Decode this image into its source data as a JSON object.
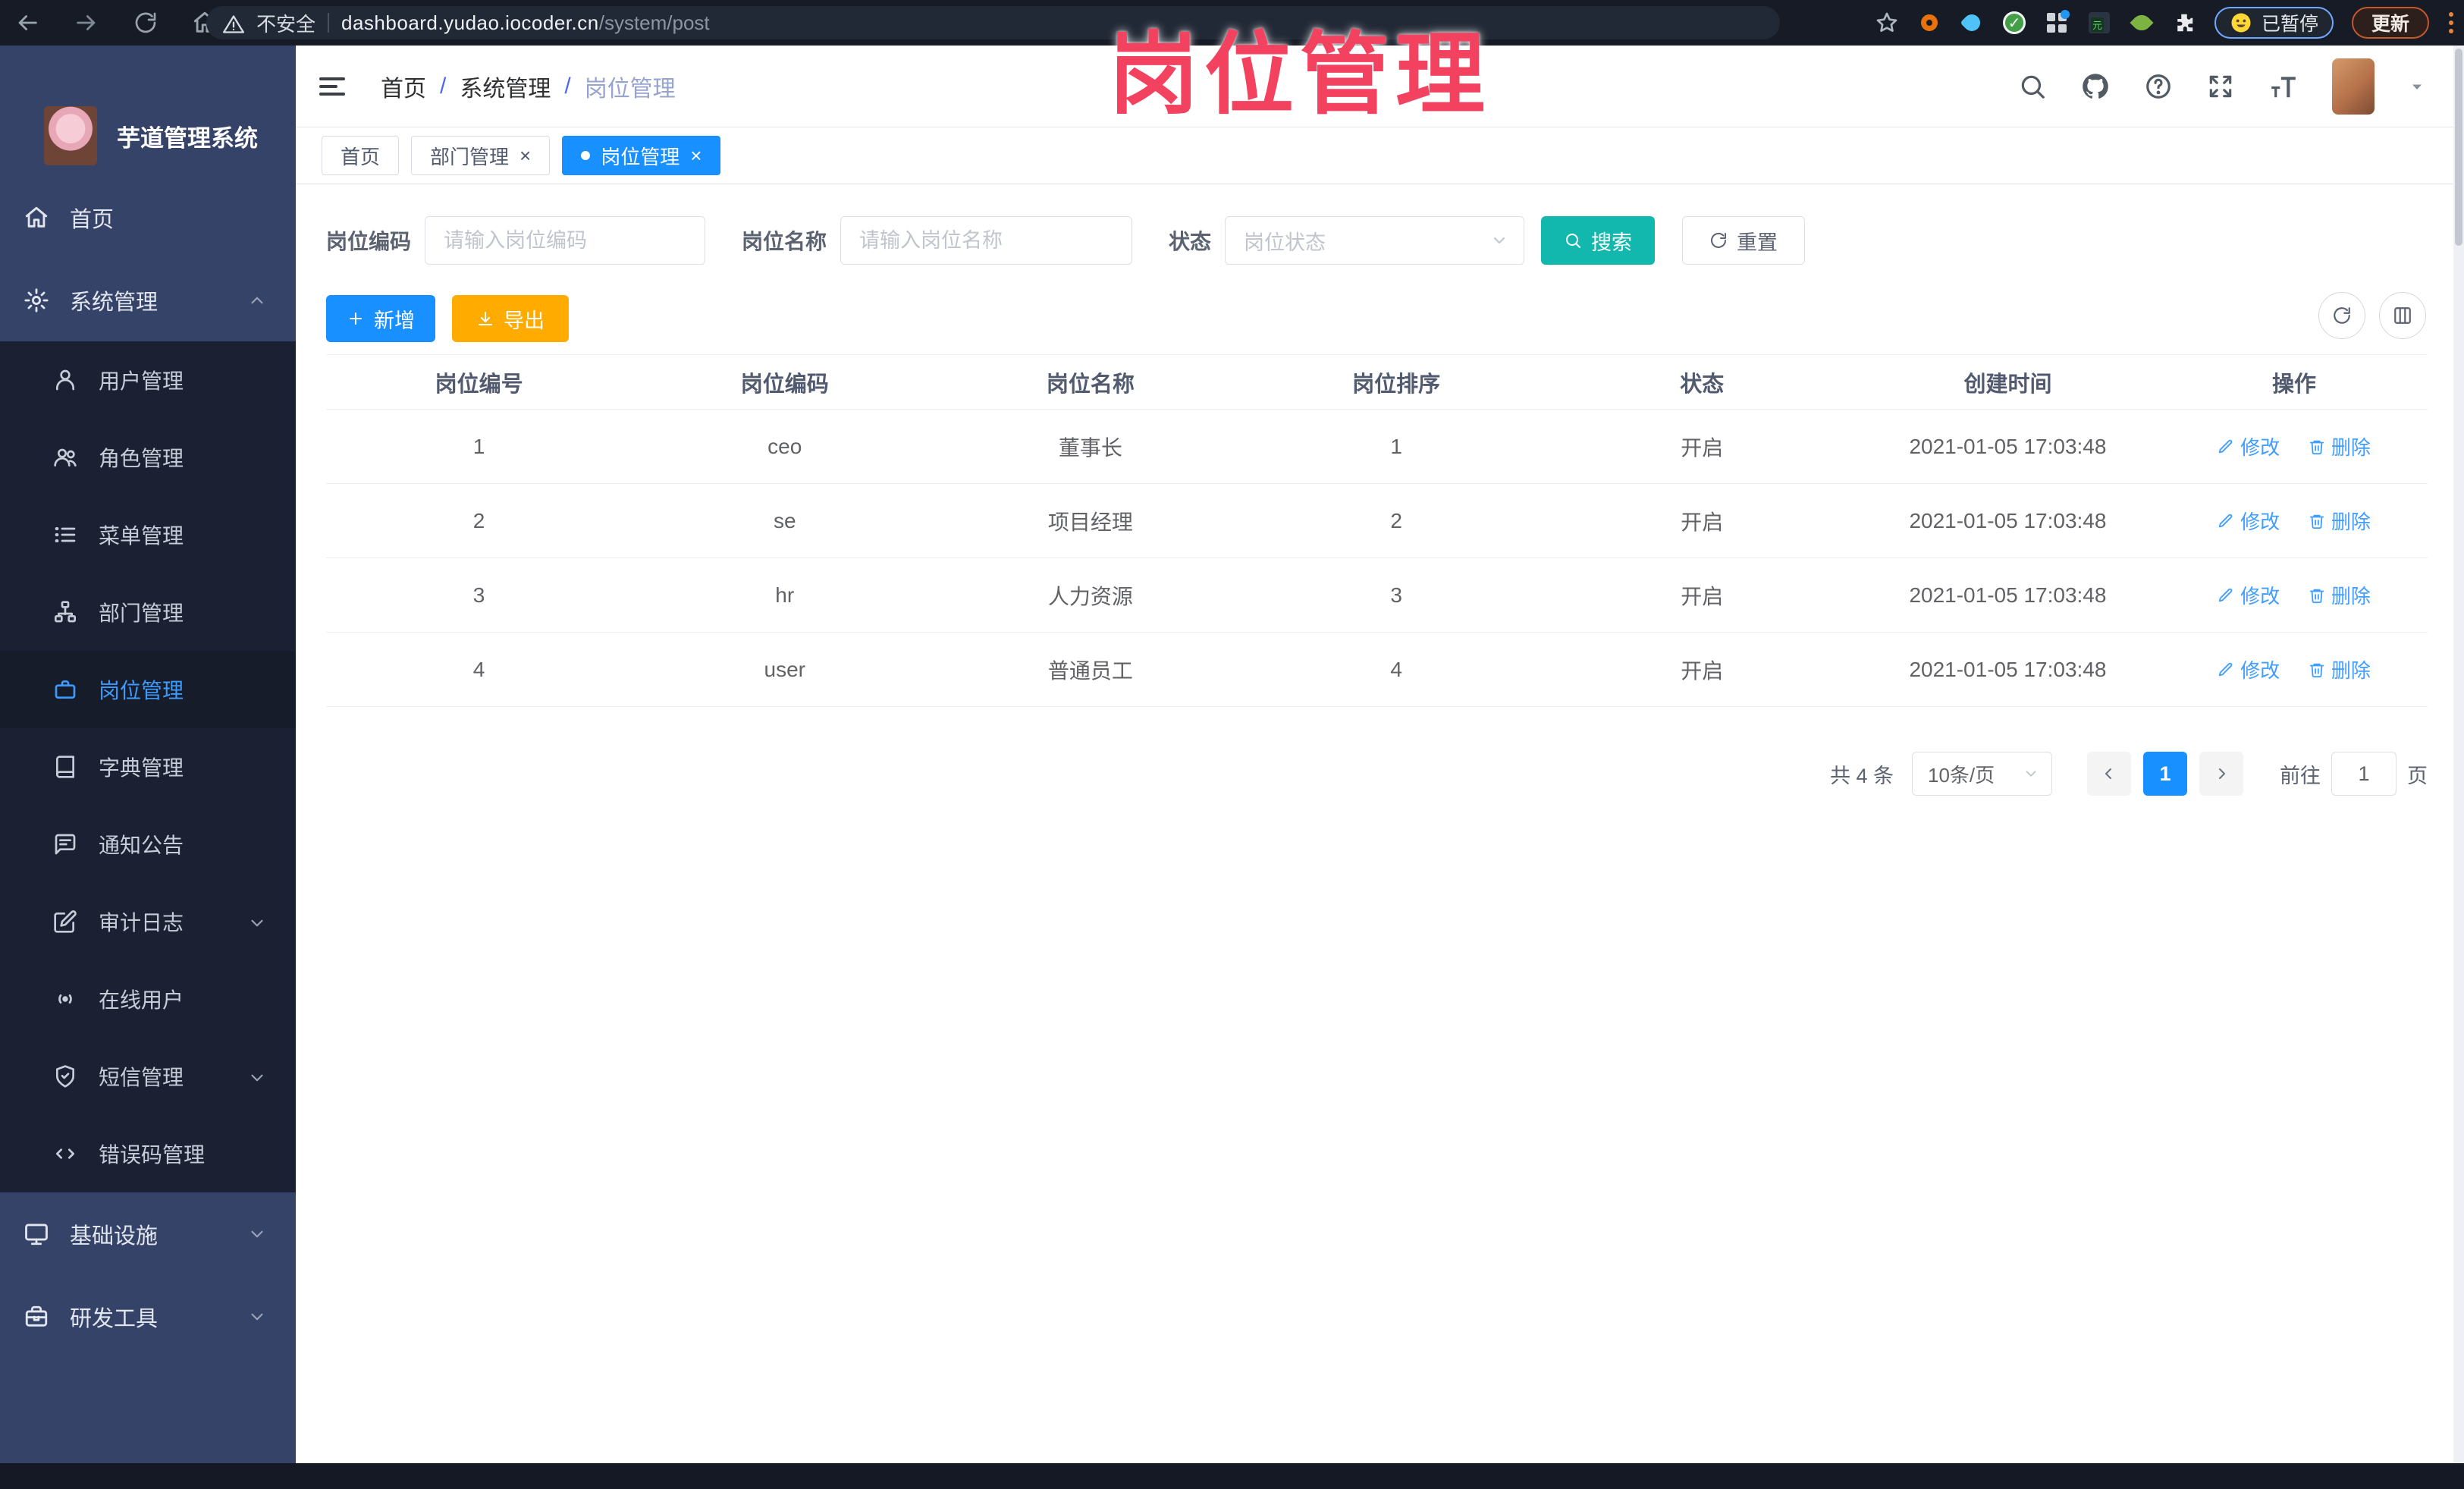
{
  "colors": {
    "accent_blue": "#1890ff",
    "link_blue": "#409eff",
    "search_teal": "#12b7ad",
    "export_orange": "#ffab00",
    "watermark_pink": "#f2425f",
    "sidebar_bg": "#364368",
    "submenu_bg": "#1b2133"
  },
  "browser": {
    "security_label": "不安全",
    "url_host": "dashboard.yudao.iocoder.cn",
    "url_path": "/system/post",
    "paused_label": "已暂停",
    "update_label": "更新"
  },
  "watermark": {
    "text": "岗位管理"
  },
  "sidebar": {
    "logo_title": "芋道管理系统",
    "items": [
      {
        "label": "首页"
      },
      {
        "label": "系统管理"
      },
      {
        "label": "用户管理"
      },
      {
        "label": "角色管理"
      },
      {
        "label": "菜单管理"
      },
      {
        "label": "部门管理"
      },
      {
        "label": "岗位管理"
      },
      {
        "label": "字典管理"
      },
      {
        "label": "通知公告"
      },
      {
        "label": "审计日志"
      },
      {
        "label": "在线用户"
      },
      {
        "label": "短信管理"
      },
      {
        "label": "错误码管理"
      },
      {
        "label": "基础设施"
      },
      {
        "label": "研发工具"
      }
    ]
  },
  "breadcrumb": {
    "items": [
      "首页",
      "系统管理",
      "岗位管理"
    ]
  },
  "tabs": [
    {
      "label": "首页"
    },
    {
      "label": "部门管理"
    },
    {
      "label": "岗位管理"
    }
  ],
  "filters": {
    "post_code_label": "岗位编码",
    "post_code_placeholder": "请输入岗位编码",
    "post_name_label": "岗位名称",
    "post_name_placeholder": "请输入岗位名称",
    "status_label": "状态",
    "status_placeholder": "岗位状态",
    "search_label": "搜索",
    "reset_label": "重置"
  },
  "toolbar": {
    "add_label": "新增",
    "export_label": "导出"
  },
  "table": {
    "headers": [
      "岗位编号",
      "岗位编码",
      "岗位名称",
      "岗位排序",
      "状态",
      "创建时间",
      "操作"
    ],
    "edit_label": "修改",
    "delete_label": "删除",
    "rows": [
      {
        "id": "1",
        "code": "ceo",
        "name": "董事长",
        "sort": "1",
        "status": "开启",
        "created": "2021-01-05 17:03:48"
      },
      {
        "id": "2",
        "code": "se",
        "name": "项目经理",
        "sort": "2",
        "status": "开启",
        "created": "2021-01-05 17:03:48"
      },
      {
        "id": "3",
        "code": "hr",
        "name": "人力资源",
        "sort": "3",
        "status": "开启",
        "created": "2021-01-05 17:03:48"
      },
      {
        "id": "4",
        "code": "user",
        "name": "普通员工",
        "sort": "4",
        "status": "开启",
        "created": "2021-01-05 17:03:48"
      }
    ]
  },
  "pagination": {
    "total_label": "共 4 条",
    "page_size_label": "10条/页",
    "current_page": "1",
    "goto_label": "前往",
    "goto_value": "1",
    "unit_label": "页"
  }
}
